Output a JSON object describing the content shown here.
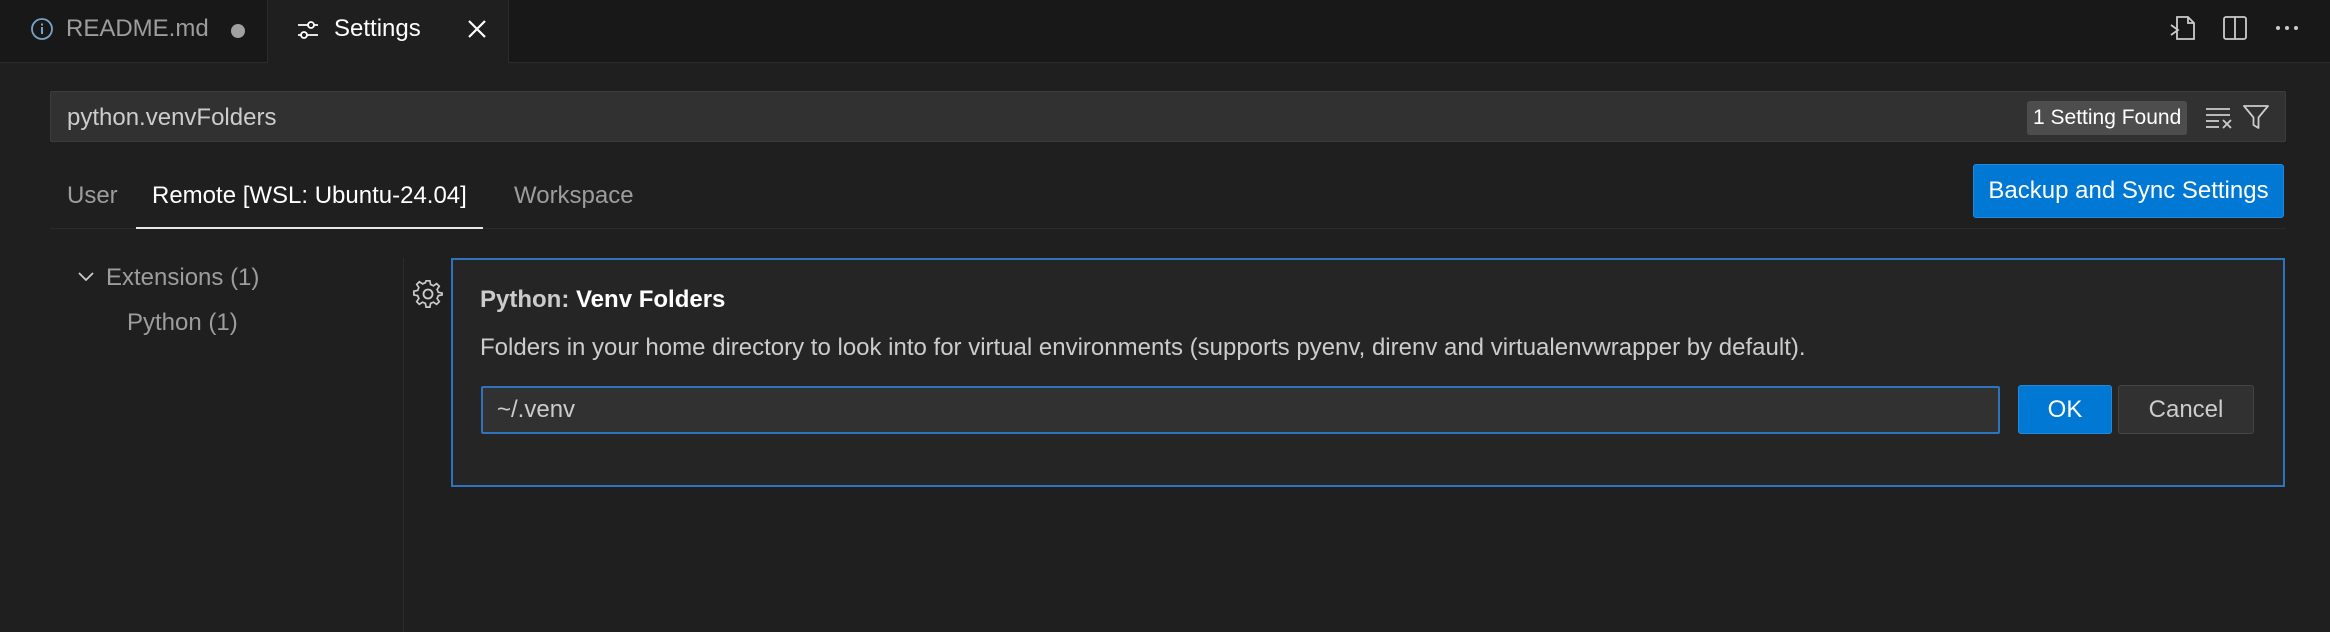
{
  "tabs": [
    {
      "label": "README.md",
      "icon": "info-icon",
      "dirty": true
    },
    {
      "label": "Settings",
      "icon": "settings-sliders-icon",
      "active": true
    }
  ],
  "title_actions": [
    "open-settings-json-icon",
    "split-editor-icon",
    "more-actions-icon"
  ],
  "search": {
    "value": "python.venvFolders",
    "result_count": "1 Setting Found"
  },
  "scope_tabs": [
    {
      "label": "User"
    },
    {
      "label": "Remote [WSL: Ubuntu-24.04]",
      "active": true
    },
    {
      "label": "Workspace"
    }
  ],
  "sync_button_label": "Backup and Sync Settings",
  "toc": {
    "extensions_label": "Extensions (1)",
    "python_label": "Python (1)"
  },
  "setting": {
    "category": "Python: ",
    "name": "Venv Folders",
    "description": "Folders in your home directory to look into for virtual environments (supports pyenv, direnv and virtualenvwrapper by default).",
    "input_value": "~/.venv",
    "ok_label": "OK",
    "cancel_label": "Cancel"
  },
  "colors": {
    "accent": "#0078d4",
    "focus_border": "#2f72bd",
    "background": "#1f1f1f"
  }
}
